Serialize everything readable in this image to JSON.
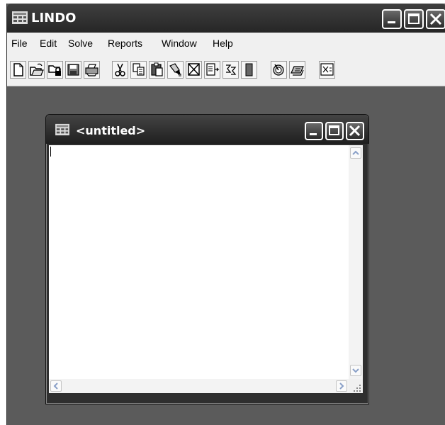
{
  "app": {
    "title": "LINDO"
  },
  "menu": [
    "File",
    "Edit",
    "Solve",
    "Reports",
    "Window",
    "Help"
  ],
  "child_window": {
    "title": "<untitled>"
  },
  "toolbar_icons": [
    "new-icon",
    "open-icon",
    "open-readonly-icon",
    "save-icon",
    "print-icon",
    "cut-icon",
    "copy-icon",
    "paste-icon",
    "clear-icon",
    "delete-icon",
    "find-icon",
    "sum-icon",
    "solve-icon",
    "compile-icon",
    "options-icon",
    "send-to-back-icon"
  ],
  "colors": {
    "workspace": "#5b5b5b",
    "titlebar": "#262626",
    "menubar": "#f0f0f0",
    "edit_area": "#ffffff"
  }
}
